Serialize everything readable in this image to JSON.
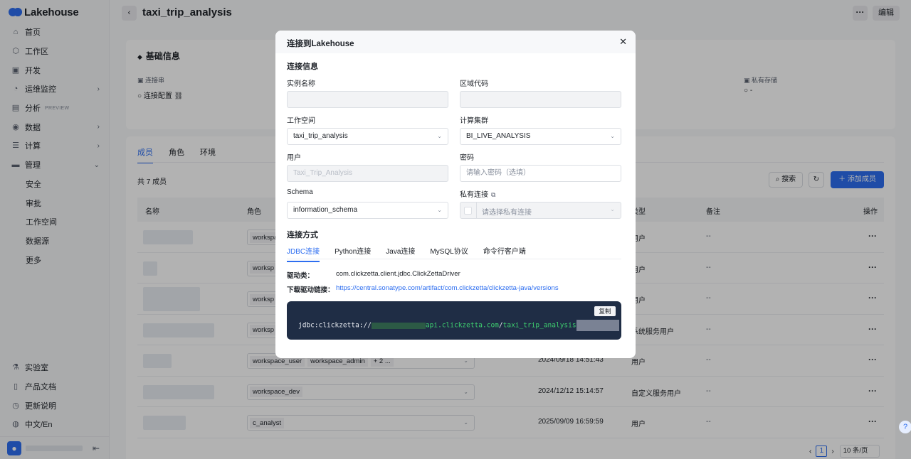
{
  "app": {
    "logo": "Lakehouse"
  },
  "sidebar": {
    "items": [
      {
        "label": "首页",
        "icon": "home-icon"
      },
      {
        "label": "工作区",
        "icon": "cube-icon"
      },
      {
        "label": "开发",
        "icon": "terminal-icon"
      },
      {
        "label": "运维监控",
        "icon": "monitor-icon"
      },
      {
        "label": "分析",
        "icon": "chart-icon",
        "tag": "PREVIEW"
      },
      {
        "label": "数据",
        "icon": "database-icon"
      },
      {
        "label": "计算",
        "icon": "compute-icon"
      },
      {
        "label": "管理",
        "icon": "manage-icon"
      }
    ],
    "sub_items": [
      "安全",
      "审批",
      "工作空间",
      "数据源",
      "更多"
    ],
    "bottom": [
      {
        "label": "实验室",
        "icon": "flask-icon"
      },
      {
        "label": "产品文档",
        "icon": "book-icon"
      },
      {
        "label": "更新说明",
        "icon": "clock-icon"
      },
      {
        "label": "中文/En",
        "icon": "globe-icon"
      }
    ]
  },
  "header": {
    "title": "taxi_trip_analysis",
    "more": "···",
    "edit": "编辑"
  },
  "basic": {
    "title": "基础信息",
    "conn_label": "连接串",
    "conn_value": "连接配置",
    "private_label": "私有存储",
    "private_value": "-"
  },
  "members": {
    "tabs": [
      "成员",
      "角色",
      "环境"
    ],
    "count": "共 7 成员",
    "search": "搜索",
    "add": "添加成员",
    "columns": {
      "name": "名称",
      "role": "角色",
      "type": "类型",
      "note": "备注",
      "op": "操作"
    },
    "rows": [
      {
        "roles": [
          "workspace"
        ],
        "time": "",
        "type": "用户",
        "note": "--"
      },
      {
        "roles": [
          "worksp"
        ],
        "time": "",
        "type": "用户",
        "note": "--"
      },
      {
        "roles": [
          "worksp"
        ],
        "time": "",
        "type": "用户",
        "note": "--"
      },
      {
        "roles": [
          "worksp"
        ],
        "time": "",
        "type": "系统服务用户",
        "note": "--"
      },
      {
        "roles": [
          "workspace_user",
          "workspace_admin",
          "+ 2 ..."
        ],
        "time": "2024/09/18 14:51:43",
        "type": "用户",
        "note": "--"
      },
      {
        "roles": [
          "workspace_dev"
        ],
        "time": "2024/12/12 15:14:57",
        "type": "自定义服务用户",
        "note": "--"
      },
      {
        "roles": [
          "c_analyst"
        ],
        "time": "2025/09/09 16:59:59",
        "type": "用户",
        "note": "--"
      }
    ],
    "page": "1",
    "page_size": "10 条/页"
  },
  "modal": {
    "title": "连接到Lakehouse",
    "section_info": "连接信息",
    "instance_label": "实例名称",
    "region_label": "区域代码",
    "workspace_label": "工作空间",
    "workspace_value": "taxi_trip_analysis",
    "cluster_label": "计算集群",
    "cluster_value": "BI_LIVE_ANALYSIS",
    "user_label": "用户",
    "user_value": "Taxi_Trip_Analysis",
    "password_label": "密码",
    "password_placeholder": "请输入密码（选填）",
    "schema_label": "Schema",
    "schema_value": "information_schema",
    "private_label": "私有连接",
    "private_placeholder": "请选择私有连接",
    "section_method": "连接方式",
    "tabs": [
      "JDBC连接",
      "Python连接",
      "Java连接",
      "MySQL协议",
      "命令行客户端"
    ],
    "driver_label": "驱动类：",
    "driver_value": "com.clickzetta.client.jdbc.ClickZettaDriver",
    "download_label": "下载驱动链接：",
    "download_value": "https://central.sonatype.com/artifact/com.clickzetta/clickzetta-java/versions",
    "copy": "复制",
    "code_prefix": "jdbc:clickzetta://",
    "code_host": "api.clickzetta.com",
    "code_slash": "/",
    "code_path": "taxi_trip_analysis"
  },
  "help": "?"
}
